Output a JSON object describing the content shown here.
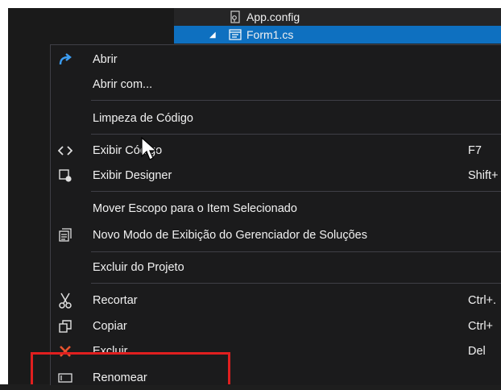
{
  "tree": {
    "items": [
      {
        "label": "App.config",
        "icon": "config-file-icon"
      },
      {
        "label": "Form1.cs",
        "icon": "form-file-icon",
        "selected": true
      }
    ]
  },
  "context_menu": {
    "items": [
      {
        "label": "Abrir",
        "icon": "open-arrow-icon",
        "shortcut": ""
      },
      {
        "label": "Abrir com...",
        "icon": "",
        "shortcut": ""
      },
      {
        "label": "Limpeza de Código",
        "icon": "",
        "shortcut": ""
      },
      {
        "label": "Exibir Código",
        "icon": "code-icon",
        "shortcut": "F7"
      },
      {
        "label": "Exibir Designer",
        "icon": "designer-icon",
        "shortcut": "Shift+"
      },
      {
        "label": "Mover Escopo para o Item Selecionado",
        "icon": "",
        "shortcut": ""
      },
      {
        "label": "Novo Modo de Exibição do Gerenciador de Soluções",
        "icon": "new-view-icon",
        "shortcut": ""
      },
      {
        "label": "Excluir do Projeto",
        "icon": "",
        "shortcut": ""
      },
      {
        "label": "Recortar",
        "icon": "scissors-icon",
        "shortcut": "Ctrl+."
      },
      {
        "label": "Copiar",
        "icon": "copy-icon",
        "shortcut": "Ctrl+"
      },
      {
        "label": "Excluir",
        "icon": "delete-x-icon",
        "shortcut": "Del"
      },
      {
        "label": "Renomear",
        "icon": "rename-icon",
        "shortcut": ""
      }
    ]
  },
  "colors": {
    "selection": "#0e70c0",
    "menu_bg": "#1b1b1c",
    "highlight_box": "#e01f1f",
    "open_icon": "#3c9df2",
    "delete_icon": "#e8532f"
  }
}
